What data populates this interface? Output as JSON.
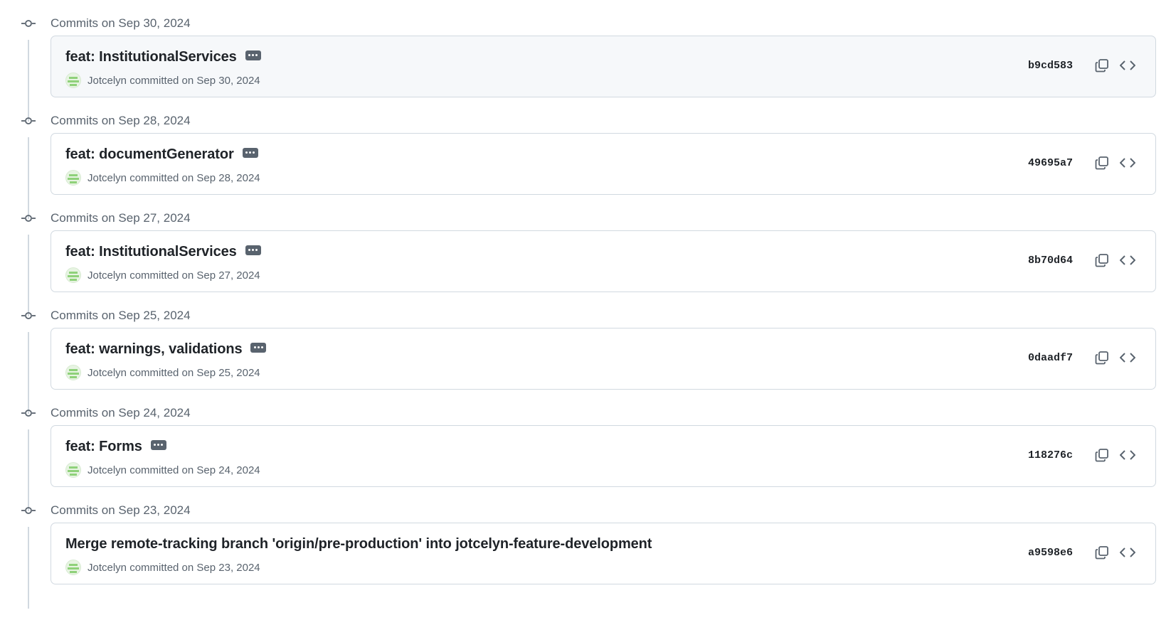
{
  "groups": [
    {
      "label": "Commits on Sep 30, 2024",
      "commit": {
        "title": "feat: InstitutionalServices",
        "has_more": true,
        "author": "Jotcelyn",
        "committed_text": "committed on Sep 30, 2024",
        "sha": "b9cd583",
        "highlighted": true
      }
    },
    {
      "label": "Commits on Sep 28, 2024",
      "commit": {
        "title": "feat: documentGenerator",
        "has_more": true,
        "author": "Jotcelyn",
        "committed_text": "committed on Sep 28, 2024",
        "sha": "49695a7",
        "highlighted": false
      }
    },
    {
      "label": "Commits on Sep 27, 2024",
      "commit": {
        "title": "feat: InstitutionalServices",
        "has_more": true,
        "author": "Jotcelyn",
        "committed_text": "committed on Sep 27, 2024",
        "sha": "8b70d64",
        "highlighted": false
      }
    },
    {
      "label": "Commits on Sep 25, 2024",
      "commit": {
        "title": "feat: warnings, validations",
        "has_more": true,
        "author": "Jotcelyn",
        "committed_text": "committed on Sep 25, 2024",
        "sha": "0daadf7",
        "highlighted": false
      }
    },
    {
      "label": "Commits on Sep 24, 2024",
      "commit": {
        "title": "feat: Forms",
        "has_more": true,
        "author": "Jotcelyn",
        "committed_text": "committed on Sep 24, 2024",
        "sha": "118276c",
        "highlighted": false
      }
    },
    {
      "label": "Commits on Sep 23, 2024",
      "commit": {
        "title": "Merge remote-tracking branch 'origin/pre-production' into jotcelyn-feature-development",
        "has_more": false,
        "author": "Jotcelyn",
        "committed_text": "committed on Sep 23, 2024",
        "sha": "a9598e6",
        "highlighted": false
      }
    }
  ],
  "icons": {
    "commit": "git-commit-icon",
    "more": "ellipsis-icon",
    "copy": "copy-icon",
    "browse": "code-icon"
  },
  "colors": {
    "text": "#1f2328",
    "muted": "#59636e",
    "border": "#d1d9e0",
    "highlight_bg": "#f6f8fa",
    "avatar": "#8fd17a"
  }
}
